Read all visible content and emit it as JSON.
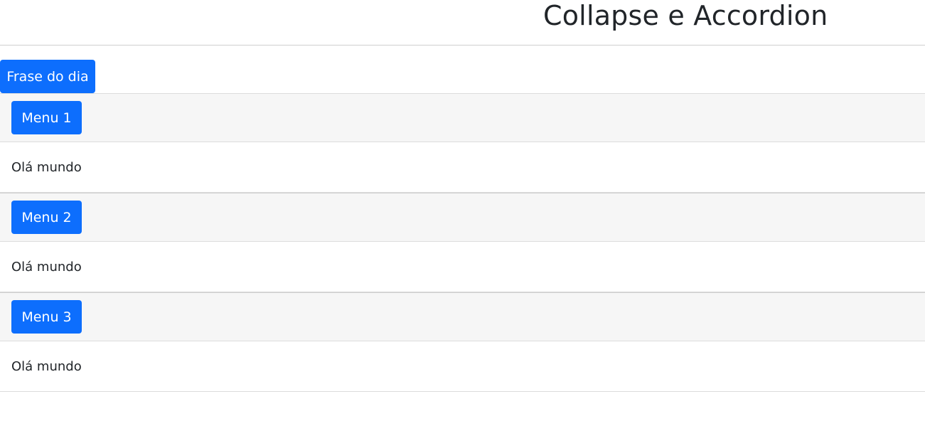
{
  "header": {
    "title": "Collapse e Accordion"
  },
  "phrase_button": {
    "label": "Frase do dia"
  },
  "accordion": {
    "items": [
      {
        "button_label": "Menu 1",
        "body_text": "Olá mundo"
      },
      {
        "button_label": "Menu 2",
        "body_text": "Olá mundo"
      },
      {
        "button_label": "Menu 3",
        "body_text": "Olá mundo"
      }
    ]
  },
  "colors": {
    "button_primary": "#0d6efd",
    "header_bg": "#f6f6f6",
    "text": "#212529",
    "divider": "#dcdcdc"
  }
}
